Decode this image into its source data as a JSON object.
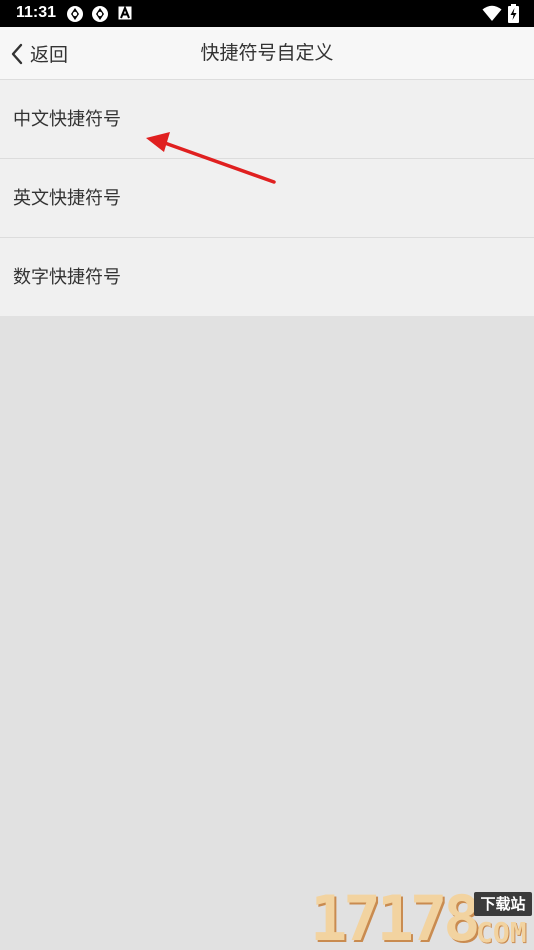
{
  "status_bar": {
    "time": "11:31",
    "icons": [
      "sync-icon",
      "sync-icon",
      "a-badge-icon",
      "wifi-icon",
      "battery-charging-icon"
    ]
  },
  "nav": {
    "back_label": "返回",
    "title": "快捷符号自定义"
  },
  "list": {
    "items": [
      {
        "label": "中文快捷符号"
      },
      {
        "label": "英文快捷符号"
      },
      {
        "label": "数字快捷符号"
      }
    ]
  },
  "annotation": {
    "icon": "red-arrow-icon",
    "color": "#e02020"
  },
  "watermark": {
    "number": "17178",
    "tag": "下载站",
    "suffix": "COM"
  },
  "colors": {
    "background": "#e1e1e1",
    "list_background": "#f0f0f0",
    "nav_background": "#f7f7f7"
  }
}
